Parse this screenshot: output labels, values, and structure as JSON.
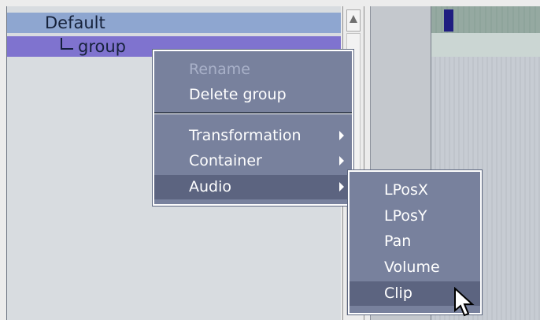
{
  "tree": {
    "items": [
      {
        "label": "Default"
      },
      {
        "label": "group"
      }
    ]
  },
  "context_menu": {
    "items": [
      {
        "label": "Rename",
        "disabled": true
      },
      {
        "label": "Delete group"
      },
      {
        "label": "Transformation"
      },
      {
        "label": "Container"
      },
      {
        "label": "Audio",
        "highlighted": true
      }
    ]
  },
  "submenu": {
    "items": [
      {
        "label": "LPosX"
      },
      {
        "label": "LPosY"
      },
      {
        "label": "Pan"
      },
      {
        "label": "Volume"
      },
      {
        "label": "Clip",
        "highlighted": true
      }
    ]
  },
  "icons": {
    "scroll_up": "scroll-up-arrow-icon",
    "submenu_arrow": "chevron-right-icon",
    "cursor": "mouse-pointer-icon"
  },
  "colors": {
    "menu_bg": "#78819d",
    "menu_highlight": "#5c6480",
    "tree_selected": "#7f73cf",
    "tree_default": "#8ea6d0"
  }
}
